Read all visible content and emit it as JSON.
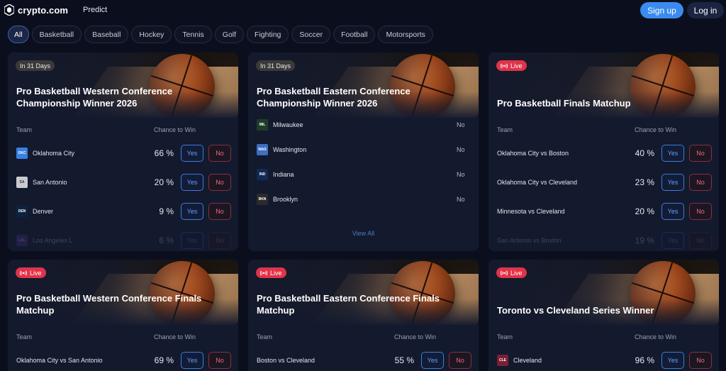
{
  "app": {
    "logo_text": "crypto.com",
    "nav_predict": "Predict"
  },
  "header": {
    "signup_label": "Sign up",
    "login_label": "Log in"
  },
  "filters": [
    "All",
    "Basketball",
    "Baseball",
    "Hockey",
    "Tennis",
    "Golf",
    "Fighting",
    "Soccer",
    "Football",
    "Motorsports"
  ],
  "labels": {
    "team": "Team",
    "chance": "Chance to Win",
    "yes": "Yes",
    "no": "No",
    "view_all": "View All"
  },
  "colors": {
    "accent": "#3a8bef",
    "live": "#e0334a",
    "yes": "#5ea0ff",
    "no": "#ef6b7c"
  },
  "cards": [
    {
      "badge": "In 31 Days",
      "badge_type": "days",
      "title": "Pro Basketball Western Conference Championship Winner 2026",
      "rows": [
        {
          "abbr": "OKC",
          "name": "Oklahoma City",
          "pct": "66 %"
        },
        {
          "abbr": "SA",
          "name": "San Antonio",
          "pct": "20 %"
        },
        {
          "abbr": "DEN",
          "name": "Denver",
          "pct": "9 %"
        },
        {
          "abbr": "LAL",
          "name": "Los Angeles L",
          "pct": "6 %"
        }
      ]
    },
    {
      "badge": "In 31 Days",
      "badge_type": "days",
      "title": "Pro Basketball Eastern Conference Championship Winner 2026",
      "rows": [
        {
          "abbr": "MIL",
          "name": "Milwaukee",
          "no": "No"
        },
        {
          "abbr": "WAS",
          "name": "Washington",
          "no": "No"
        },
        {
          "abbr": "IND",
          "name": "Indiana",
          "no": "No"
        },
        {
          "abbr": "BKN",
          "name": "Brooklyn",
          "no": "No"
        }
      ]
    },
    {
      "badge": "Live",
      "badge_type": "live",
      "title": "Pro Basketball Finals Matchup",
      "rows": [
        {
          "name": "Oklahoma City vs Boston",
          "pct": "40 %"
        },
        {
          "name": "Oklahoma City vs Cleveland",
          "pct": "23 %"
        },
        {
          "name": "Minnesota vs Cleveland",
          "pct": "20 %"
        },
        {
          "name": "San Antonio vs Boston",
          "pct": "19 %"
        }
      ]
    },
    {
      "badge": "Live",
      "badge_type": "live",
      "title": "Pro Basketball Western Conference Finals Matchup",
      "rows": [
        {
          "name": "Oklahoma City vs San Antonio",
          "pct": "69 %"
        }
      ]
    },
    {
      "badge": "Live",
      "badge_type": "live",
      "title": "Pro Basketball Eastern Conference Finals Matchup",
      "rows": [
        {
          "name": "Boston vs Cleveland",
          "pct": "55 %"
        }
      ]
    },
    {
      "badge": "Live",
      "badge_type": "live",
      "title": "Toronto vs Cleveland Series Winner",
      "rows": [
        {
          "abbr": "CLE",
          "name": "Cleveland",
          "pct": "96 %"
        }
      ]
    }
  ]
}
